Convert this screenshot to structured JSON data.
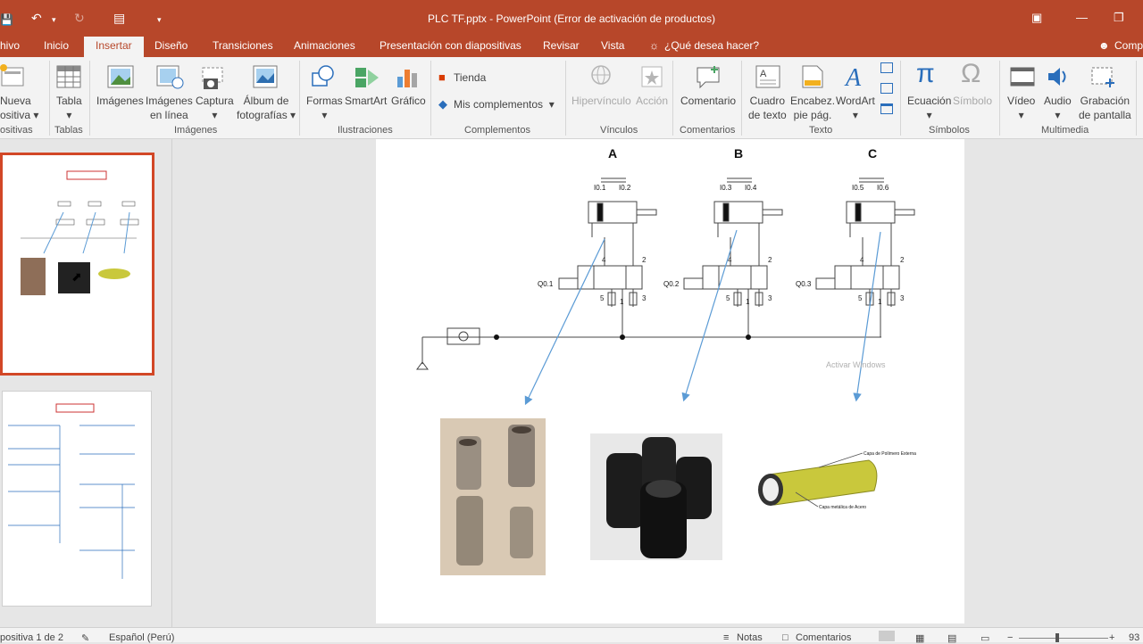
{
  "window": {
    "title": "PLC TF.pptx - PowerPoint (Error de activación de productos)"
  },
  "tabs": [
    "hivo",
    "Inicio",
    "Insertar",
    "Diseño",
    "Transiciones",
    "Animaciones",
    "Presentación con diapositivas",
    "Revisar",
    "Vista"
  ],
  "tell_me": "¿Qué desea hacer?",
  "share": "Comp",
  "ribbon": {
    "new_slide": [
      "Nueva",
      "ositiva"
    ],
    "table": "Tabla",
    "images": "Imágenes",
    "online_images": [
      "Imágenes",
      "en línea"
    ],
    "capture": "Captura",
    "album": [
      "Álbum de",
      "fotografías"
    ],
    "shapes": "Formas",
    "smartart": "SmartArt",
    "chart": "Gráfico",
    "store": "Tienda",
    "my_addins": "Mis complementos",
    "hyperlink": "Hipervínculo",
    "action": "Acción",
    "comment": "Comentario",
    "textbox": [
      "Cuadro",
      "de texto"
    ],
    "header": [
      "Encabez.",
      "pie pág."
    ],
    "wordart": "WordArt",
    "equation": "Ecuación",
    "symbol": "Símbolo",
    "video": "Vídeo",
    "audio": "Audio",
    "recording": [
      "Grabación",
      "de pantalla"
    ],
    "groups": [
      "ositivas",
      "Tablas",
      "Imágenes",
      "Ilustraciones",
      "Complementos",
      "Vínculos",
      "Comentarios",
      "Texto",
      "Símbolos",
      "Multimedia"
    ]
  },
  "slide": {
    "cylinders": [
      {
        "label": "A",
        "sensors": [
          "I0.1",
          "I0.2"
        ],
        "valve": "Q0.1"
      },
      {
        "label": "B",
        "sensors": [
          "I0.3",
          "I0.4"
        ],
        "valve": "Q0.2"
      },
      {
        "label": "C",
        "sensors": [
          "I0.5",
          "I0.6"
        ],
        "valve": "Q0.3"
      }
    ],
    "ports": [
      "4",
      "2",
      "5",
      "1",
      "3"
    ],
    "watermark": "Activar Windows",
    "tube_labels": [
      "Capa de Polímero Externa",
      "Capa metálica de Acero"
    ]
  },
  "status": {
    "slide_of": "positiva 1 de 2",
    "language": "Español (Perú)",
    "notes": "Notas",
    "comments": "Comentarios",
    "zoom": "93"
  },
  "colors": {
    "accent": "#b7472a",
    "arrow": "#5b9bd5",
    "tube": "#c9c83c"
  }
}
